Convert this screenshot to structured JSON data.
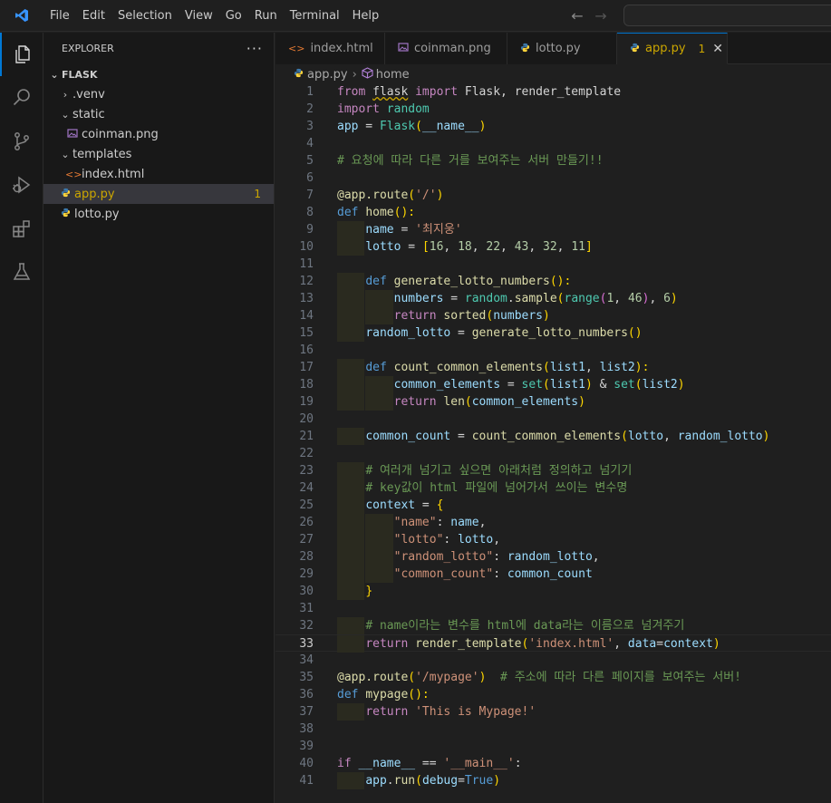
{
  "menu": [
    "File",
    "Edit",
    "Selection",
    "View",
    "Go",
    "Run",
    "Terminal",
    "Help"
  ],
  "explorer": {
    "title": "EXPLORER",
    "more": "···",
    "root": "FLASK",
    "items": [
      {
        "label": ".venv",
        "type": "folder-collapsed"
      },
      {
        "label": "static",
        "type": "folder-open"
      },
      {
        "label": "coinman.png",
        "type": "image"
      },
      {
        "label": "templates",
        "type": "folder-open"
      },
      {
        "label": "index.html",
        "type": "html"
      },
      {
        "label": "app.py",
        "type": "python",
        "badge": "1"
      },
      {
        "label": "lotto.py",
        "type": "python"
      }
    ]
  },
  "tabs": [
    {
      "label": "index.html",
      "icon": "html-icon"
    },
    {
      "label": "coinman.png",
      "icon": "image-icon"
    },
    {
      "label": "lotto.py",
      "icon": "python-icon"
    },
    {
      "label": "app.py",
      "icon": "python-icon",
      "badge": "1",
      "close": "✕"
    }
  ],
  "breadcrumb": {
    "file": "app.py",
    "symbol": "home"
  },
  "editor": {
    "current_line": 33,
    "lines": [
      [
        {
          "t": "from",
          "c": "kw"
        },
        {
          "t": " "
        },
        {
          "t": "flask",
          "c": "plain squig"
        },
        {
          "t": " "
        },
        {
          "t": "import",
          "c": "kw"
        },
        {
          "t": " Flask, render_template",
          "c": "plain"
        }
      ],
      [
        {
          "t": "import",
          "c": "kw"
        },
        {
          "t": " "
        },
        {
          "t": "random",
          "c": "cls"
        }
      ],
      [
        {
          "t": "app",
          "c": "var"
        },
        {
          "t": " = ",
          "c": "plain"
        },
        {
          "t": "Flask",
          "c": "cls"
        },
        {
          "t": "(",
          "c": "br1"
        },
        {
          "t": "__name__",
          "c": "var"
        },
        {
          "t": ")",
          "c": "br1"
        }
      ],
      [],
      [
        {
          "t": "# 요청에 따라 다른 거를 보여주는 서버 만들기!!",
          "c": "cm"
        }
      ],
      [],
      [
        {
          "t": "@app.route",
          "c": "fn"
        },
        {
          "t": "(",
          "c": "br1"
        },
        {
          "t": "'/'",
          "c": "str"
        },
        {
          "t": ")",
          "c": "br1"
        }
      ],
      [
        {
          "t": "def",
          "c": "kd"
        },
        {
          "t": " "
        },
        {
          "t": "home",
          "c": "fn"
        },
        {
          "t": "():",
          "c": "br1"
        }
      ],
      [
        {
          "t": "    "
        },
        {
          "t": "name",
          "c": "var"
        },
        {
          "t": " = ",
          "c": "plain"
        },
        {
          "t": "'최지웅'",
          "c": "str"
        }
      ],
      [
        {
          "t": "    "
        },
        {
          "t": "lotto",
          "c": "var"
        },
        {
          "t": " = ",
          "c": "plain"
        },
        {
          "t": "[",
          "c": "br1"
        },
        {
          "t": "16",
          "c": "num"
        },
        {
          "t": ", ",
          "c": "plain"
        },
        {
          "t": "18",
          "c": "num"
        },
        {
          "t": ", ",
          "c": "plain"
        },
        {
          "t": "22",
          "c": "num"
        },
        {
          "t": ", ",
          "c": "plain"
        },
        {
          "t": "43",
          "c": "num"
        },
        {
          "t": ", ",
          "c": "plain"
        },
        {
          "t": "32",
          "c": "num"
        },
        {
          "t": ", ",
          "c": "plain"
        },
        {
          "t": "11",
          "c": "num"
        },
        {
          "t": "]",
          "c": "br1"
        }
      ],
      [],
      [
        {
          "t": "    "
        },
        {
          "t": "def",
          "c": "kd"
        },
        {
          "t": " "
        },
        {
          "t": "generate_lotto_numbers",
          "c": "fn"
        },
        {
          "t": "():",
          "c": "br1"
        }
      ],
      [
        {
          "t": "        "
        },
        {
          "t": "numbers",
          "c": "var"
        },
        {
          "t": " = ",
          "c": "plain"
        },
        {
          "t": "random",
          "c": "cls"
        },
        {
          "t": ".",
          "c": "plain"
        },
        {
          "t": "sample",
          "c": "fn"
        },
        {
          "t": "(",
          "c": "br1"
        },
        {
          "t": "range",
          "c": "cls"
        },
        {
          "t": "(",
          "c": "br2"
        },
        {
          "t": "1",
          "c": "num"
        },
        {
          "t": ", ",
          "c": "plain"
        },
        {
          "t": "46",
          "c": "num"
        },
        {
          "t": ")",
          "c": "br2"
        },
        {
          "t": ", ",
          "c": "plain"
        },
        {
          "t": "6",
          "c": "num"
        },
        {
          "t": ")",
          "c": "br1"
        }
      ],
      [
        {
          "t": "        "
        },
        {
          "t": "return",
          "c": "kw"
        },
        {
          "t": " "
        },
        {
          "t": "sorted",
          "c": "fn"
        },
        {
          "t": "(",
          "c": "br1"
        },
        {
          "t": "numbers",
          "c": "var"
        },
        {
          "t": ")",
          "c": "br1"
        }
      ],
      [
        {
          "t": "    "
        },
        {
          "t": "random_lotto",
          "c": "var"
        },
        {
          "t": " = ",
          "c": "plain"
        },
        {
          "t": "generate_lotto_numbers",
          "c": "fn"
        },
        {
          "t": "()",
          "c": "br1"
        }
      ],
      [],
      [
        {
          "t": "    "
        },
        {
          "t": "def",
          "c": "kd"
        },
        {
          "t": " "
        },
        {
          "t": "count_common_elements",
          "c": "fn"
        },
        {
          "t": "(",
          "c": "br1"
        },
        {
          "t": "list1",
          "c": "var"
        },
        {
          "t": ", ",
          "c": "plain"
        },
        {
          "t": "list2",
          "c": "var"
        },
        {
          "t": "):",
          "c": "br1"
        }
      ],
      [
        {
          "t": "        "
        },
        {
          "t": "common_elements",
          "c": "var"
        },
        {
          "t": " = ",
          "c": "plain"
        },
        {
          "t": "set",
          "c": "cls"
        },
        {
          "t": "(",
          "c": "br1"
        },
        {
          "t": "list1",
          "c": "var"
        },
        {
          "t": ")",
          "c": "br1"
        },
        {
          "t": " & ",
          "c": "plain"
        },
        {
          "t": "set",
          "c": "cls"
        },
        {
          "t": "(",
          "c": "br1"
        },
        {
          "t": "list2",
          "c": "var"
        },
        {
          "t": ")",
          "c": "br1"
        }
      ],
      [
        {
          "t": "        "
        },
        {
          "t": "return",
          "c": "kw"
        },
        {
          "t": " "
        },
        {
          "t": "len",
          "c": "fn"
        },
        {
          "t": "(",
          "c": "br1"
        },
        {
          "t": "common_elements",
          "c": "var"
        },
        {
          "t": ")",
          "c": "br1"
        }
      ],
      [],
      [
        {
          "t": "    "
        },
        {
          "t": "common_count",
          "c": "var"
        },
        {
          "t": " = ",
          "c": "plain"
        },
        {
          "t": "count_common_elements",
          "c": "fn"
        },
        {
          "t": "(",
          "c": "br1"
        },
        {
          "t": "lotto",
          "c": "var"
        },
        {
          "t": ", ",
          "c": "plain"
        },
        {
          "t": "random_lotto",
          "c": "var"
        },
        {
          "t": ")",
          "c": "br1"
        }
      ],
      [],
      [
        {
          "t": "    "
        },
        {
          "t": "# 여러개 넘기고 싶으면 아래처럼 정의하고 넘기기",
          "c": "cm"
        }
      ],
      [
        {
          "t": "    "
        },
        {
          "t": "# key값이 html 파일에 넘어가서 쓰이는 변수명",
          "c": "cm"
        }
      ],
      [
        {
          "t": "    "
        },
        {
          "t": "context",
          "c": "var"
        },
        {
          "t": " = ",
          "c": "plain"
        },
        {
          "t": "{",
          "c": "br1"
        }
      ],
      [
        {
          "t": "        "
        },
        {
          "t": "\"name\"",
          "c": "str"
        },
        {
          "t": ": ",
          "c": "plain"
        },
        {
          "t": "name",
          "c": "var"
        },
        {
          "t": ",",
          "c": "plain"
        }
      ],
      [
        {
          "t": "        "
        },
        {
          "t": "\"lotto\"",
          "c": "str"
        },
        {
          "t": ": ",
          "c": "plain"
        },
        {
          "t": "lotto",
          "c": "var"
        },
        {
          "t": ",",
          "c": "plain"
        }
      ],
      [
        {
          "t": "        "
        },
        {
          "t": "\"random_lotto\"",
          "c": "str"
        },
        {
          "t": ": ",
          "c": "plain"
        },
        {
          "t": "random_lotto",
          "c": "var"
        },
        {
          "t": ",",
          "c": "plain"
        }
      ],
      [
        {
          "t": "        "
        },
        {
          "t": "\"common_count\"",
          "c": "str"
        },
        {
          "t": ": ",
          "c": "plain"
        },
        {
          "t": "common_count",
          "c": "var"
        }
      ],
      [
        {
          "t": "    "
        },
        {
          "t": "}",
          "c": "br1"
        }
      ],
      [],
      [
        {
          "t": "    "
        },
        {
          "t": "# name이라는 변수를 html에 data라는 이름으로 넘겨주기",
          "c": "cm"
        }
      ],
      [
        {
          "t": "    "
        },
        {
          "t": "return",
          "c": "kw"
        },
        {
          "t": " "
        },
        {
          "t": "render_template",
          "c": "fn"
        },
        {
          "t": "(",
          "c": "br1"
        },
        {
          "t": "'index.html'",
          "c": "str"
        },
        {
          "t": ", ",
          "c": "plain"
        },
        {
          "t": "data",
          "c": "var"
        },
        {
          "t": "=",
          "c": "plain"
        },
        {
          "t": "context",
          "c": "var"
        },
        {
          "t": ")",
          "c": "br1"
        }
      ],
      [],
      [
        {
          "t": "@app.route",
          "c": "fn"
        },
        {
          "t": "(",
          "c": "br1"
        },
        {
          "t": "'/mypage'",
          "c": "str"
        },
        {
          "t": ")",
          "c": "br1"
        },
        {
          "t": "  "
        },
        {
          "t": "# 주소에 따라 다른 페이지를 보여주는 서버!",
          "c": "cm"
        }
      ],
      [
        {
          "t": "def",
          "c": "kd"
        },
        {
          "t": " "
        },
        {
          "t": "mypage",
          "c": "fn"
        },
        {
          "t": "():",
          "c": "br1"
        }
      ],
      [
        {
          "t": "    "
        },
        {
          "t": "return",
          "c": "kw"
        },
        {
          "t": " "
        },
        {
          "t": "'This is Mypage!'",
          "c": "str"
        }
      ],
      [],
      [],
      [
        {
          "t": "if",
          "c": "kw"
        },
        {
          "t": " "
        },
        {
          "t": "__name__",
          "c": "var"
        },
        {
          "t": " == ",
          "c": "plain"
        },
        {
          "t": "'__main__'",
          "c": "str"
        },
        {
          "t": ":",
          "c": "plain"
        }
      ],
      [
        {
          "t": "    "
        },
        {
          "t": "app",
          "c": "var"
        },
        {
          "t": ".",
          "c": "plain"
        },
        {
          "t": "run",
          "c": "fn"
        },
        {
          "t": "(",
          "c": "br1"
        },
        {
          "t": "debug",
          "c": "var"
        },
        {
          "t": "=",
          "c": "plain"
        },
        {
          "t": "True",
          "c": "kd"
        },
        {
          "t": ")",
          "c": "br1"
        }
      ]
    ],
    "indent_guides": {
      "9": 1,
      "10": 1,
      "11": 0,
      "12": 1,
      "13": 2,
      "14": 2,
      "15": 1,
      "16": 0,
      "17": 1,
      "18": 2,
      "19": 2,
      "20": 0,
      "21": 1,
      "22": 0,
      "23": 1,
      "24": 1,
      "25": 1,
      "26": 2,
      "27": 2,
      "28": 2,
      "29": 2,
      "30": 1,
      "31": 0,
      "32": 1,
      "33": 1,
      "37": 1,
      "41": 1
    }
  },
  "colors": {
    "accent": "#0078d4",
    "warning": "#cca700",
    "python": "#3c78aa"
  }
}
